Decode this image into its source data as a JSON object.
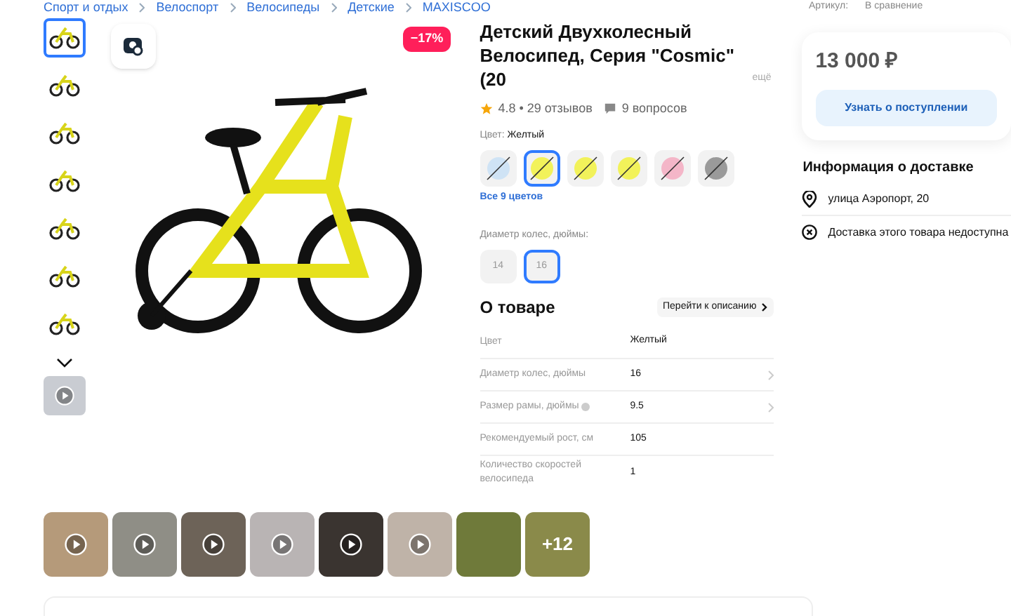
{
  "breadcrumbs": [
    "Спорт и отдых",
    "Велоспорт",
    "Велосипеды",
    "Детские",
    "MAXISCOO"
  ],
  "top_meta": {
    "article": "Артикул:",
    "compare": "В сравнение"
  },
  "gallery": {
    "thumbnails": [
      {
        "kind": "photo",
        "selected": true
      },
      {
        "kind": "photo",
        "selected": false
      },
      {
        "kind": "photo",
        "selected": false
      },
      {
        "kind": "photo",
        "selected": false
      },
      {
        "kind": "photo",
        "selected": false
      },
      {
        "kind": "photo",
        "selected": false
      },
      {
        "kind": "photo",
        "selected": false
      },
      {
        "kind": "video",
        "selected": false
      }
    ],
    "discount": "−17%"
  },
  "product": {
    "title": "Детский Двухколесный Велосипед, Серия \"Cosmic\" (20",
    "more": "ещё",
    "rating": "4.8 • 29 отзывов",
    "questions": "9 вопросов",
    "color_label": "Цвет:",
    "color_value": "Желтый",
    "colors": [
      {
        "color": "#cfe3f5",
        "selected": false
      },
      {
        "color": "#f2f25a",
        "selected": true
      },
      {
        "color": "#f2f25a",
        "selected": false
      },
      {
        "color": "#f2f25a",
        "selected": false
      },
      {
        "color": "#f4b6c8",
        "selected": false
      },
      {
        "color": "#9a9a9a",
        "selected": false
      }
    ],
    "all_colors": "Все 9 цветов",
    "wheel_label": "Диаметр колес, дюймы:",
    "wheel_options": [
      {
        "label": "14",
        "selected": false
      },
      {
        "label": "16",
        "selected": true
      }
    ],
    "about_title": "О товаре",
    "about_link": "Перейти к описанию",
    "specs": [
      {
        "name": "Цвет",
        "value": "Желтый",
        "kind": "plain"
      },
      {
        "name": "Диаметр колес, дюймы",
        "value": "16",
        "kind": "link"
      },
      {
        "name": "Размер рамы, дюймы",
        "value": "9.5",
        "kind": "info"
      },
      {
        "name": "Рекомендуемый рост, см",
        "value": "105",
        "kind": "plain"
      },
      {
        "name": "Количество скоростей велосипеда",
        "value": "1",
        "kind": "plain"
      }
    ]
  },
  "offer": {
    "price": "13 000 ₽",
    "notify_button": "Узнать о поступлении"
  },
  "delivery": {
    "title": "Информация о доставке",
    "items": [
      {
        "kind": "location",
        "text": "улица Аэропорт, 20"
      },
      {
        "kind": "unavailable",
        "text": "Доставка этого товара недоступна"
      }
    ]
  },
  "media": {
    "items": [
      {
        "kind": "video"
      },
      {
        "kind": "video"
      },
      {
        "kind": "video"
      },
      {
        "kind": "video"
      },
      {
        "kind": "video"
      },
      {
        "kind": "video"
      },
      {
        "kind": "photo"
      },
      {
        "kind": "more",
        "text": "+12"
      }
    ]
  }
}
